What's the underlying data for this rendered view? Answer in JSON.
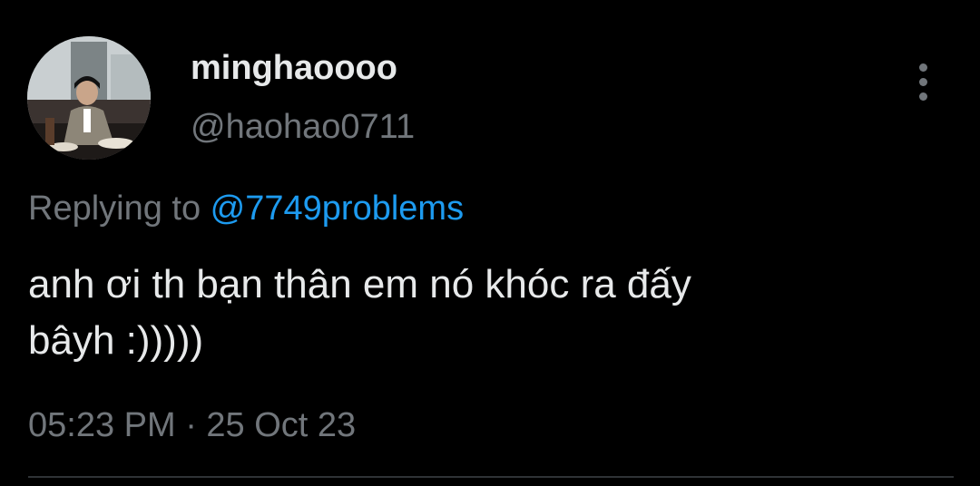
{
  "tweet": {
    "display_name": "minghaoooo",
    "handle": "@haohao0711",
    "replying_prefix": "Replying to ",
    "replying_to": "@7749problems",
    "text": "anh ơi th bạn thân em nó khóc ra đấy\nbâyh :)))))",
    "timestamp": "05:23 PM · 25 Oct 23",
    "more_icon": "more-vertical-icon"
  },
  "colors": {
    "background": "#000000",
    "text_primary": "#e7e9ea",
    "text_secondary": "#71767b",
    "link": "#1d9bf0",
    "divider": "#2f3336"
  }
}
